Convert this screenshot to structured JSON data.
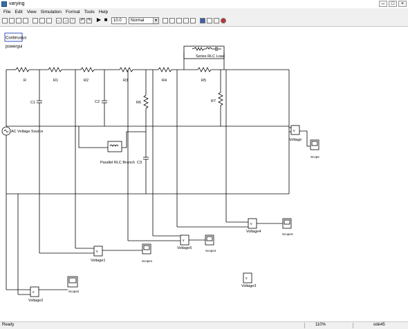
{
  "window": {
    "title": "varying"
  },
  "menu": [
    "File",
    "Edit",
    "View",
    "Simulation",
    "Format",
    "Tools",
    "Help"
  ],
  "toolbar": {
    "stop_time": "10.0",
    "sim_mode": "Normal"
  },
  "blocks": {
    "powergui_name": "Continuous",
    "powergui_label": "powergui",
    "source": "AC Voltage Source",
    "resistors": [
      "R",
      "R1",
      "R2",
      "R3",
      "R4",
      "R5",
      "R6",
      "R7"
    ],
    "capacitors": [
      "C1",
      "C2",
      "C3"
    ],
    "series_rlc": "Series RLC Load",
    "parallel_rlc": "Parallel RLC Branch",
    "voltage_blocks": [
      "Voltage",
      "Voltage1",
      "Voltage2",
      "Voltage3",
      "Voltage4",
      "Voltage5"
    ],
    "scopes": [
      "Scope",
      "Scope1",
      "Scope2",
      "Scope3",
      "Scope4"
    ]
  },
  "status": {
    "left": "Ready",
    "zoom": "110%",
    "solver": "ode45"
  }
}
